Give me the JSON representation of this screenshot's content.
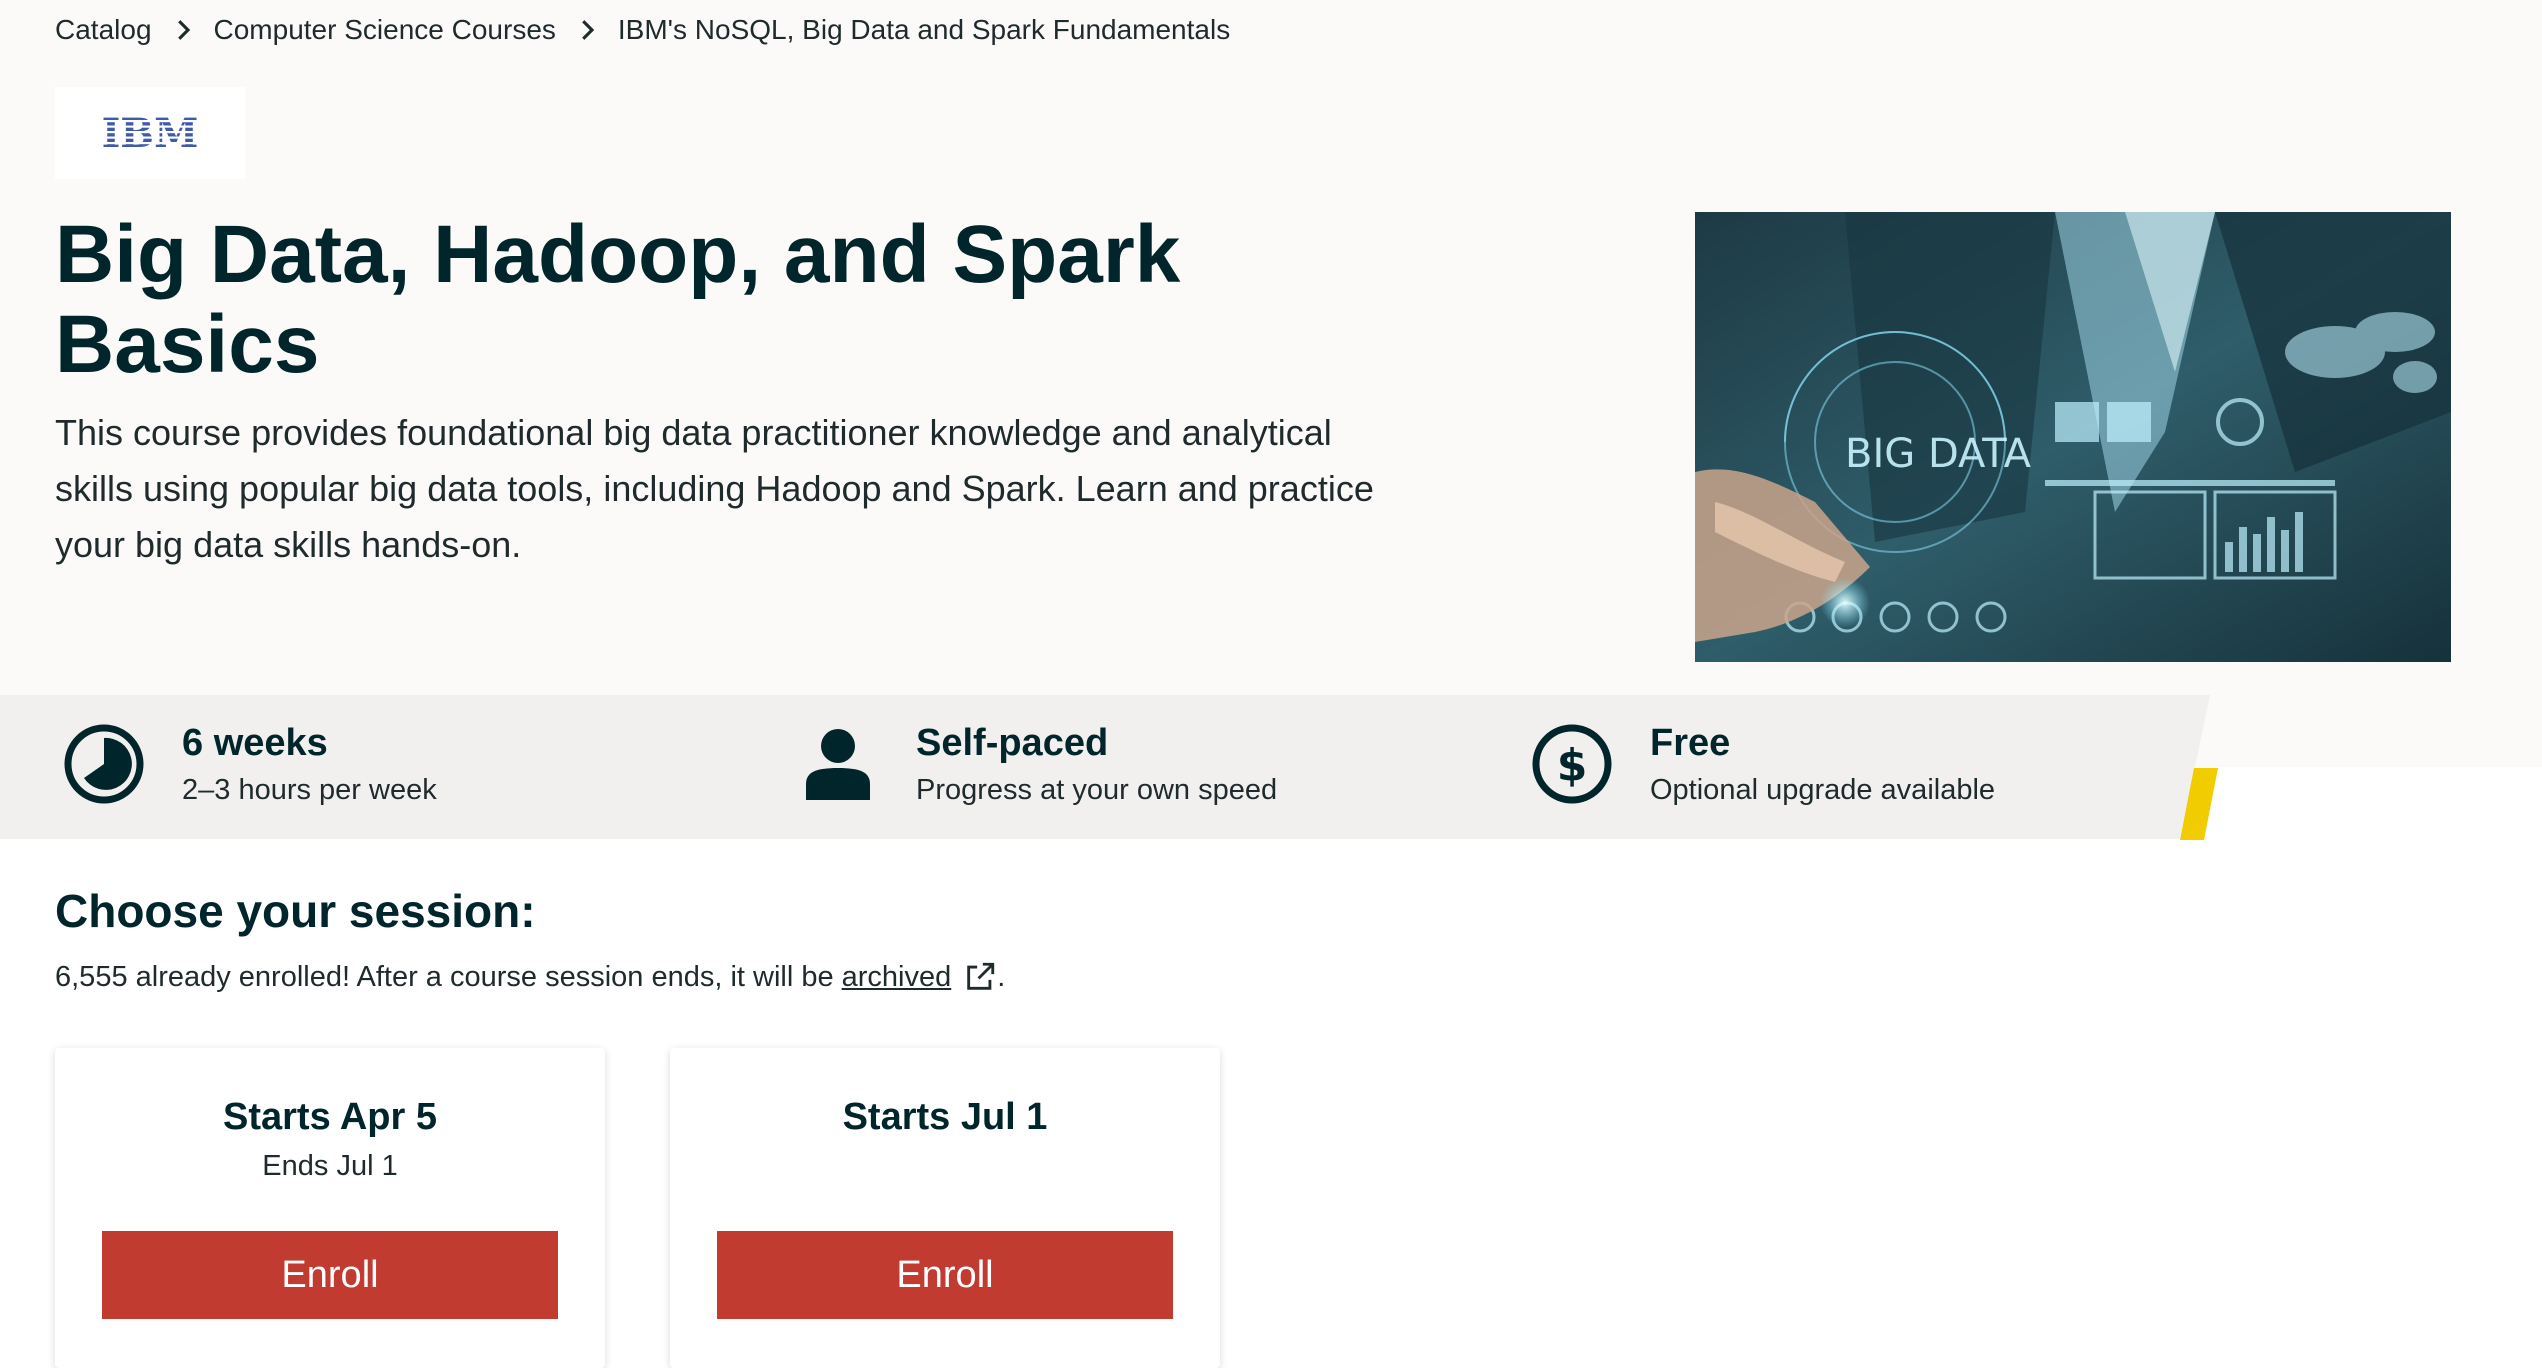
{
  "breadcrumb": {
    "items": [
      "Catalog",
      "Computer Science Courses",
      "IBM's NoSQL, Big Data and Spark Fundamentals"
    ]
  },
  "logo": {
    "text": "IBM"
  },
  "course": {
    "title": "Big Data, Hadoop, and Spark Basics",
    "description": "This course provides foundational big data practitioner knowledge and analytical skills using popular big data tools, including Hadoop and Spark. Learn and practice your big data skills hands-on."
  },
  "hero_image": {
    "overlay_text": "BIG DATA"
  },
  "facts": [
    {
      "icon": "clock-icon",
      "title": "6 weeks",
      "subtitle": "2–3 hours per week"
    },
    {
      "icon": "person-icon",
      "title": "Self-paced",
      "subtitle": "Progress at your own speed"
    },
    {
      "icon": "dollar-icon",
      "title": "Free",
      "subtitle": "Optional upgrade available"
    }
  ],
  "session": {
    "heading": "Choose your session:",
    "note_text": "6,555 already enrolled! After a course session ends, it will be",
    "note_link": "archived",
    "note_end": ".",
    "cards": [
      {
        "start": "Starts Apr 5",
        "end": "Ends Jul 1",
        "button": "Enroll"
      },
      {
        "start": "Starts Jul 1",
        "end": "",
        "button": "Enroll"
      }
    ]
  },
  "colors": {
    "hero_background": "#fbfaf9",
    "facts_background": "#f1f0ef",
    "accent_yellow": "#f0cc00",
    "enroll_button": "#c23b31",
    "heading_text": "#00262b"
  }
}
